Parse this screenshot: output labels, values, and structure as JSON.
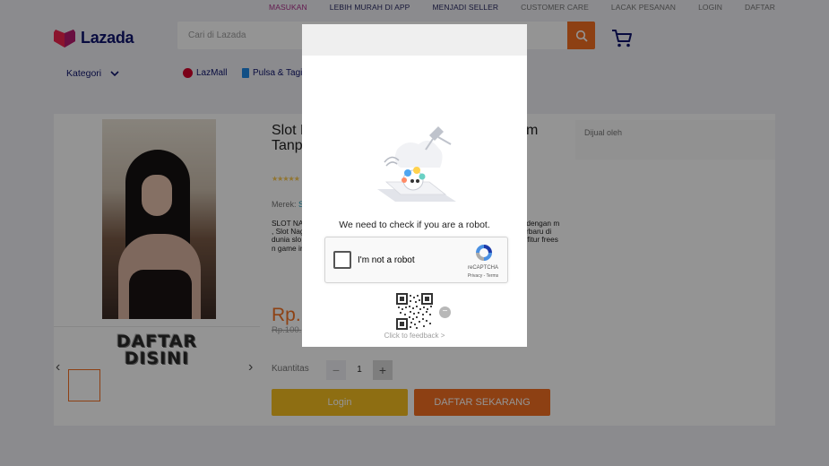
{
  "topbar": {
    "links": [
      "MASUKAN",
      "LEBIH MURAH DI APP",
      "MENJADI SELLER",
      "CUSTOMER CARE",
      "LACAK PESANAN",
      "LOGIN",
      "DAFTAR"
    ]
  },
  "header": {
    "logo_text": "Lazada",
    "search_placeholder": "Cari di Lazada",
    "kategori_label": "Kategori",
    "nav_lazmall": "LazMall",
    "nav_pulsa": "Pulsa & Tagi"
  },
  "product": {
    "title": "Slot N                                    Hitam Tanp",
    "title_left": "Slot N",
    "title_right": "Hitam",
    "title_line2": "Tanp",
    "stars": "★★★★★",
    "brand_label": "Merek:",
    "brand_value": "Sl",
    "description": "SLOT NAG                                    t online terbaru y                                    win dengan m                                    , Slot Naga Hita                                    enang besar tan                                    rbaru di dunia slo                                    bisa merasaka                                    P tinggi, fitur frees                                    n game ini dicintai o",
    "price": "Rp.1",
    "old_price": "Rp.100.",
    "quantity_label": "Kuantitas",
    "quantity_value": "1",
    "qty_minus": "−",
    "qty_plus": "+",
    "login_button": "Login",
    "daftar_button": "DAFTAR SEKARANG",
    "sold_by": "Dijual oleh"
  },
  "gallery": {
    "banner_line1": "DAFTAR",
    "banner_line2": "DISINI",
    "prev": "‹",
    "next": "›"
  },
  "captcha": {
    "message": "We need to check if you are a robot.",
    "checkbox_label": "I'm not a robot",
    "brand": "reCAPTCHA",
    "terms": "Privacy - Terms",
    "feedback": "Click to feedback >",
    "close": "−"
  },
  "colors": {
    "accent": "#f36f21",
    "brand_navy": "#0f146d",
    "login_yellow": "#f5bd20"
  }
}
